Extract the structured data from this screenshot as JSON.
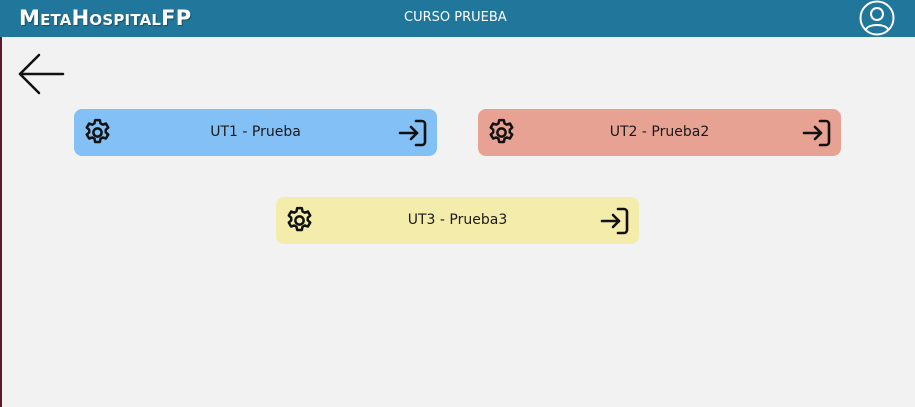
{
  "header": {
    "brand": "MetaHospitalFP",
    "course_title": "CURSO PRUEBA",
    "background": "#21779b"
  },
  "icons": {
    "user": "user-circle-icon",
    "back": "arrow-left-icon",
    "settings": "gear-icon",
    "enter": "login-arrow-icon"
  },
  "units": [
    {
      "label": "UT1 - Prueba",
      "color": "#82c0f5"
    },
    {
      "label": "UT2 - Prueba2",
      "color": "#e8a293"
    },
    {
      "label": "UT3 - Prueba3",
      "color": "#f4ecaa"
    }
  ]
}
